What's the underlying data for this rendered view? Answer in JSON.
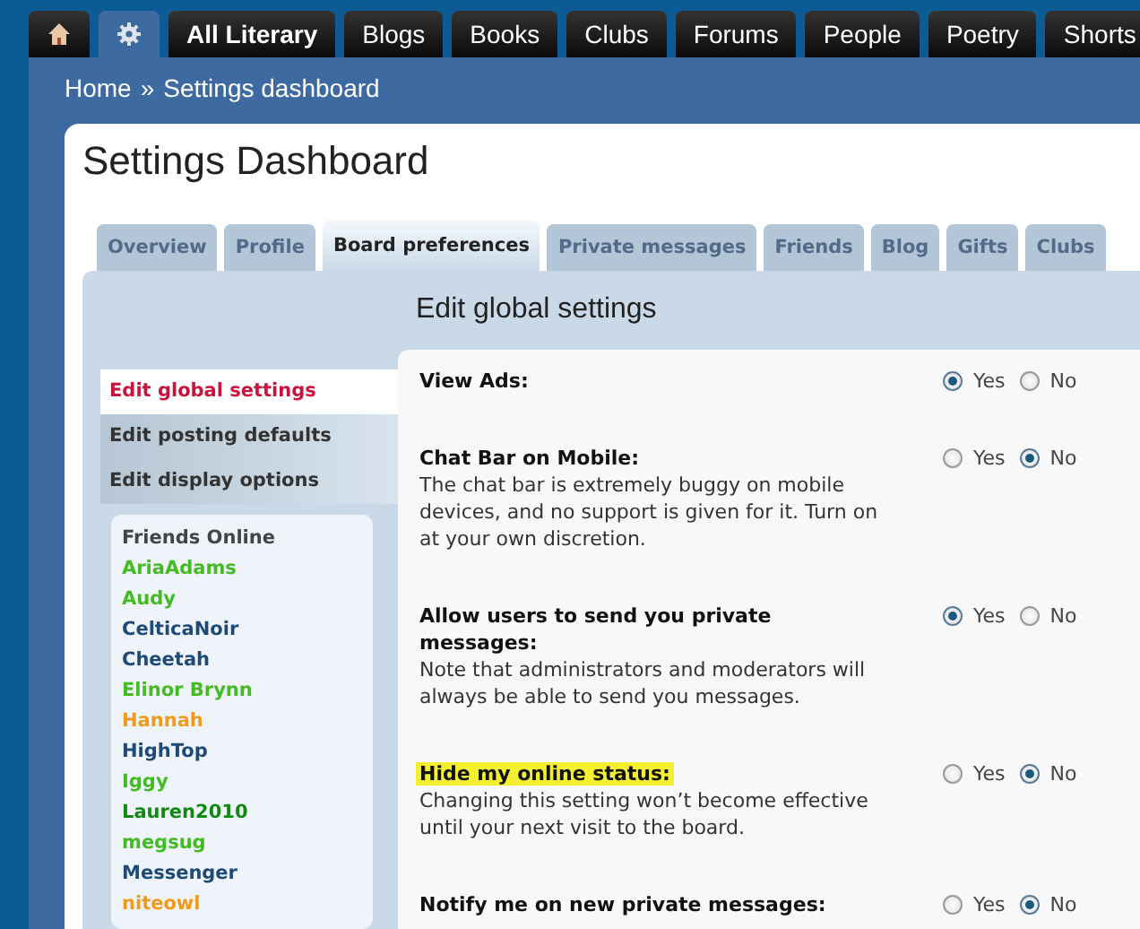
{
  "nav": [
    {
      "kind": "home",
      "selected": false
    },
    {
      "kind": "settings",
      "selected": true
    },
    {
      "kind": "link",
      "label": "All Literary",
      "selected": false,
      "bold": true
    },
    {
      "kind": "link",
      "label": "Blogs",
      "selected": false,
      "bold": false
    },
    {
      "kind": "link",
      "label": "Books",
      "selected": false,
      "bold": false
    },
    {
      "kind": "link",
      "label": "Clubs",
      "selected": false,
      "bold": false
    },
    {
      "kind": "link",
      "label": "Forums",
      "selected": false,
      "bold": false
    },
    {
      "kind": "link",
      "label": "People",
      "selected": false,
      "bold": false
    },
    {
      "kind": "link",
      "label": "Poetry",
      "selected": false,
      "bold": false
    },
    {
      "kind": "link",
      "label": "Shorts",
      "selected": false,
      "bold": false
    }
  ],
  "breadcrumb": [
    "Home",
    "»",
    "Settings dashboard"
  ],
  "title": "Settings Dashboard",
  "tabs": [
    {
      "label": "Overview",
      "selected": false
    },
    {
      "label": "Profile",
      "selected": false
    },
    {
      "label": "Board preferences",
      "selected": true
    },
    {
      "label": "Private messages",
      "selected": false
    },
    {
      "label": "Friends",
      "selected": false
    },
    {
      "label": "Blog",
      "selected": false
    },
    {
      "label": "Gifts",
      "selected": false
    },
    {
      "label": "Clubs",
      "selected": false
    }
  ],
  "section_title": "Edit global settings",
  "menu": [
    {
      "label": "Edit global settings",
      "selected": true
    },
    {
      "label": "Edit posting defaults",
      "selected": false
    },
    {
      "label": "Edit display options",
      "selected": false
    }
  ],
  "friends": {
    "title": "Friends Online",
    "items": [
      {
        "name": "AriaAdams",
        "color": "#44bb22"
      },
      {
        "name": "Audy",
        "color": "#44bb22"
      },
      {
        "name": "CelticaNoir",
        "color": "#1e4a78"
      },
      {
        "name": "Cheetah",
        "color": "#1e4a78"
      },
      {
        "name": "Elinor Brynn",
        "color": "#44bb22"
      },
      {
        "name": "Hannah",
        "color": "#f09a1a"
      },
      {
        "name": "HighTop",
        "color": "#1e4a78"
      },
      {
        "name": "Iggy",
        "color": "#44bb22"
      },
      {
        "name": "Lauren2010",
        "color": "#118811"
      },
      {
        "name": "megsug",
        "color": "#44bb22"
      },
      {
        "name": "Messenger",
        "color": "#1e4a78"
      },
      {
        "name": "niteowl",
        "color": "#f09a1a"
      }
    ]
  },
  "settings": [
    {
      "title": "View Ads:",
      "highlighted": false,
      "options": [
        {
          "label": "Yes",
          "selected": true
        },
        {
          "label": "No",
          "selected": false
        }
      ]
    },
    {
      "title": "Chat Bar on Mobile:",
      "highlighted": false,
      "description": "The chat bar is extremely buggy on mobile devices, and no support is given for it. Turn on at your own discretion.",
      "options": [
        {
          "label": "Yes",
          "selected": false
        },
        {
          "label": "No",
          "selected": true
        }
      ]
    },
    {
      "title": "Allow users to send you private messages:",
      "highlighted": false,
      "description": "Note that administrators and moderators will always be able to send you messages.",
      "options": [
        {
          "label": "Yes",
          "selected": true
        },
        {
          "label": "No",
          "selected": false
        }
      ]
    },
    {
      "title": "Hide my online status:",
      "highlighted": true,
      "description": "Changing this setting won’t become effective until your next visit to the board.",
      "options": [
        {
          "label": "Yes",
          "selected": false
        },
        {
          "label": "No",
          "selected": true
        }
      ]
    },
    {
      "title": "Notify me on new private messages:",
      "highlighted": false,
      "options": [
        {
          "label": "Yes",
          "selected": false
        },
        {
          "label": "No",
          "selected": true
        }
      ]
    }
  ]
}
